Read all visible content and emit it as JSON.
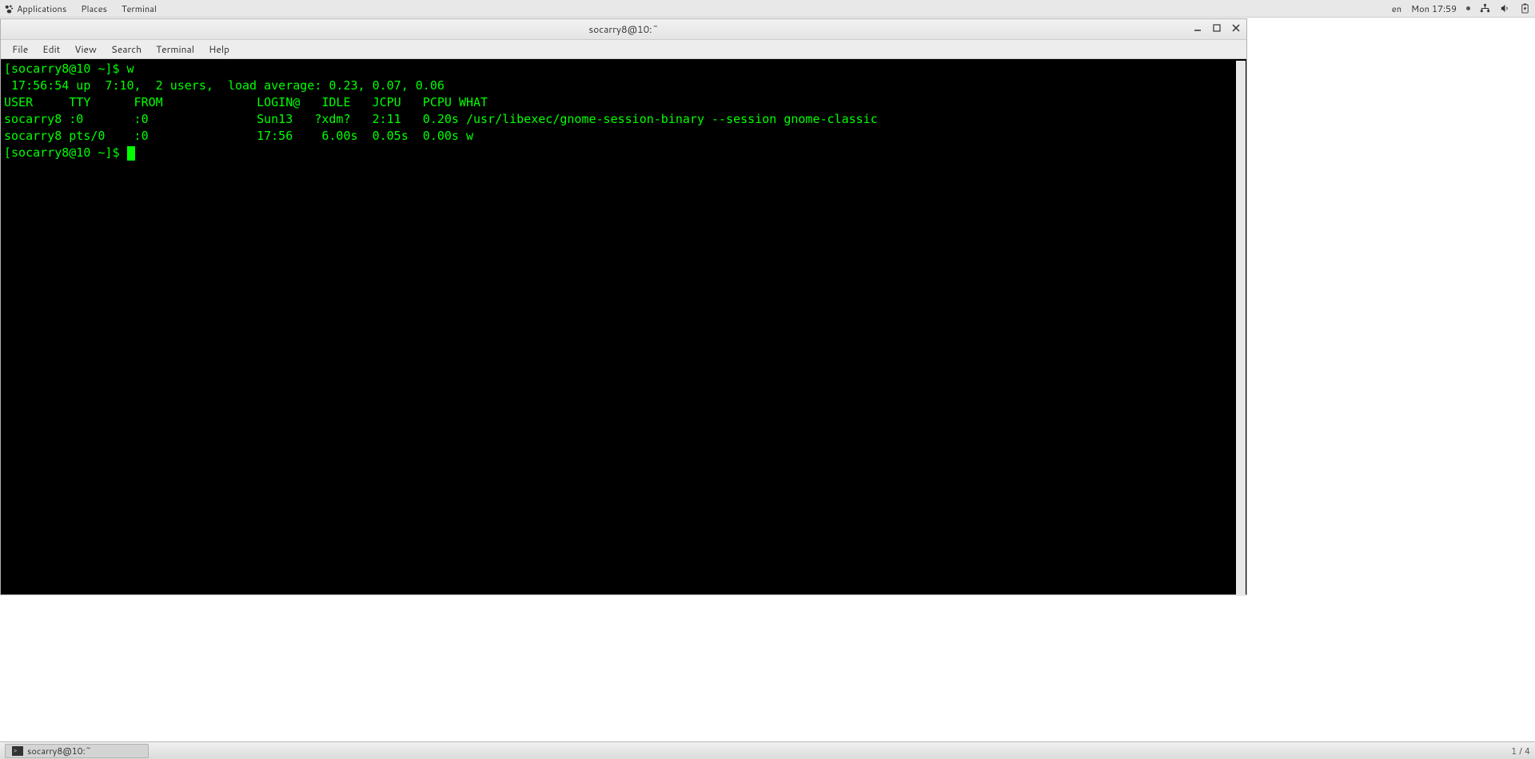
{
  "panel": {
    "applications": "Applications",
    "places": "Places",
    "terminal": "Terminal",
    "lang": "en",
    "clock": "Mon 17:59"
  },
  "window": {
    "title": "socarry8@10:~"
  },
  "menu": {
    "file": "File",
    "edit": "Edit",
    "view": "View",
    "search": "Search",
    "terminal": "Terminal",
    "help": "Help"
  },
  "terminal": {
    "line1": "[socarry8@10 ~]$ w",
    "line2": " 17:56:54 up  7:10,  2 users,  load average: 0.23, 0.07, 0.06",
    "line3": "USER     TTY      FROM             LOGIN@   IDLE   JCPU   PCPU WHAT",
    "line4": "socarry8 :0       :0               Sun13   ?xdm?   2:11   0.20s /usr/libexec/gnome-session-binary --session gnome-classic",
    "line5": "socarry8 pts/0    :0               17:56    6.00s  0.05s  0.00s w",
    "prompt": "[socarry8@10 ~]$ "
  },
  "taskbar": {
    "button": "socarry8@10:~",
    "pager": "1 / 4"
  }
}
